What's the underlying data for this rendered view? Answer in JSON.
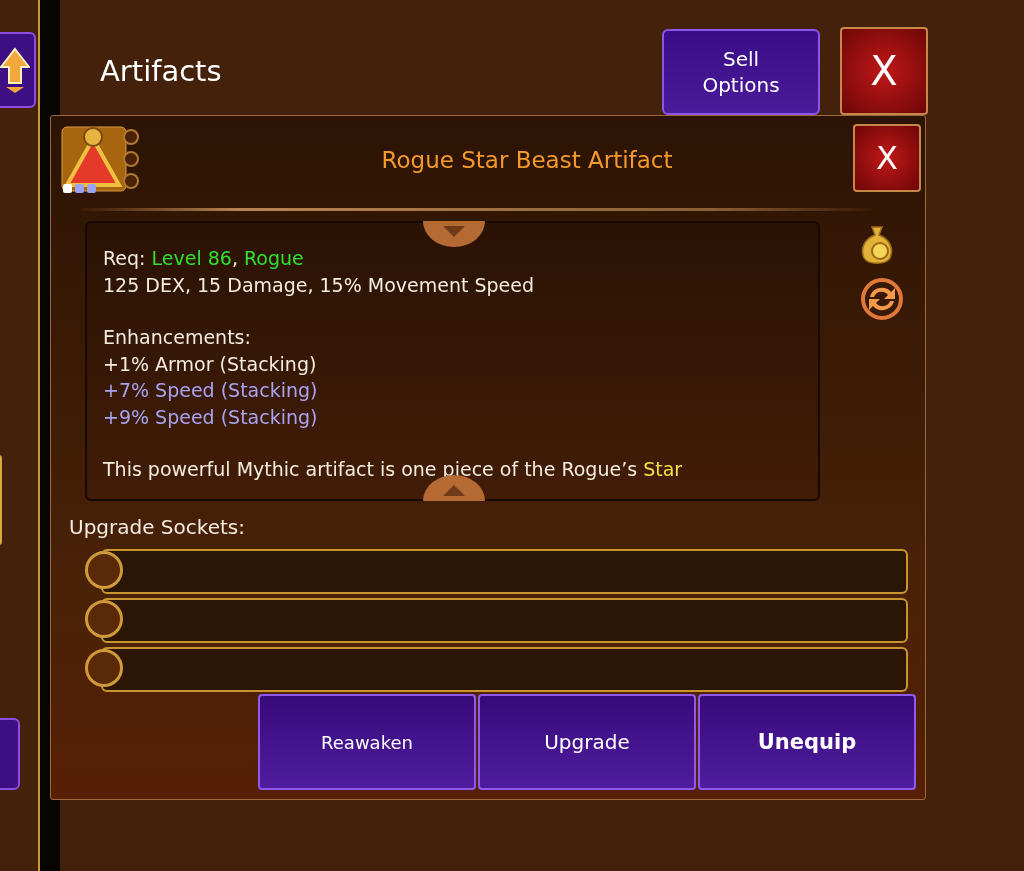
{
  "header": {
    "title": "Artifacts",
    "sell_button": "Sell\nOptions",
    "close_button": "X"
  },
  "item": {
    "title": "Rogue Star Beast Artifact",
    "close_button": "X",
    "paragraphs": [
      [
        [
          {
            "text": "Req: "
          },
          {
            "text": "Level 86",
            "color": "#2fe02f"
          },
          {
            "text": ", "
          },
          {
            "text": "Rogue",
            "color": "#2fe02f"
          }
        ],
        [
          {
            "text": "125 DEX, 15 Damage, 15% Movement Speed"
          }
        ]
      ],
      [
        [
          {
            "text": "Enhancements:"
          }
        ],
        [
          {
            "text": "+1% Armor (Stacking)"
          }
        ],
        [
          {
            "text": "+7% Speed (Stacking)",
            "color": "#a9a3f0"
          }
        ],
        [
          {
            "text": "+9% Speed (Stacking)",
            "color": "#a9a3f0"
          }
        ]
      ],
      [
        [
          {
            "text": "This powerful Mythic artifact is one piece of the Rogue’s "
          },
          {
            "text": "Star",
            "color": "#f3e046"
          }
        ]
      ]
    ],
    "sockets_label": "Upgrade Sockets:",
    "sockets": [
      {
        "kind": "empty"
      },
      {
        "kind": "empty"
      },
      {
        "kind": "empty"
      }
    ],
    "actions": [
      "Reawaken",
      "Upgrade",
      "Unequip"
    ]
  }
}
